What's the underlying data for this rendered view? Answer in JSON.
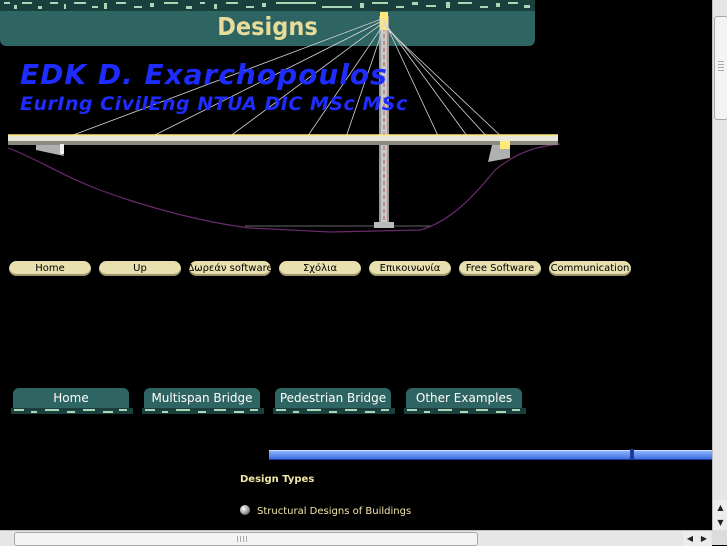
{
  "header": {
    "title": "EDK D. Exarchopoulos",
    "subtitle": "EurIng CivilEng NTUA DIC MSc MSc"
  },
  "top_nav": [
    {
      "label": "Home"
    },
    {
      "label": "Up"
    },
    {
      "label": "Δωρεάν software"
    },
    {
      "label": "Σχόλια"
    },
    {
      "label": "Επικοινωνία"
    },
    {
      "label": "Free Software"
    },
    {
      "label": "Communication"
    }
  ],
  "banner": {
    "title": "Designs"
  },
  "sub_tabs": [
    {
      "label": "Home"
    },
    {
      "label": "Multispan Bridge"
    },
    {
      "label": "Pedestrian Bridge"
    },
    {
      "label": "Other Examples"
    }
  ],
  "content": {
    "section_heading": "Design Types",
    "items": [
      {
        "label": "Structural Designs of Buildings"
      }
    ]
  },
  "colors": {
    "title_blue": "#1e2cff",
    "nav_pill": "#e8e0ae",
    "banner_teal": "#2e6461",
    "banner_text": "#e8dc9a",
    "content_text": "#f2e6a8"
  }
}
